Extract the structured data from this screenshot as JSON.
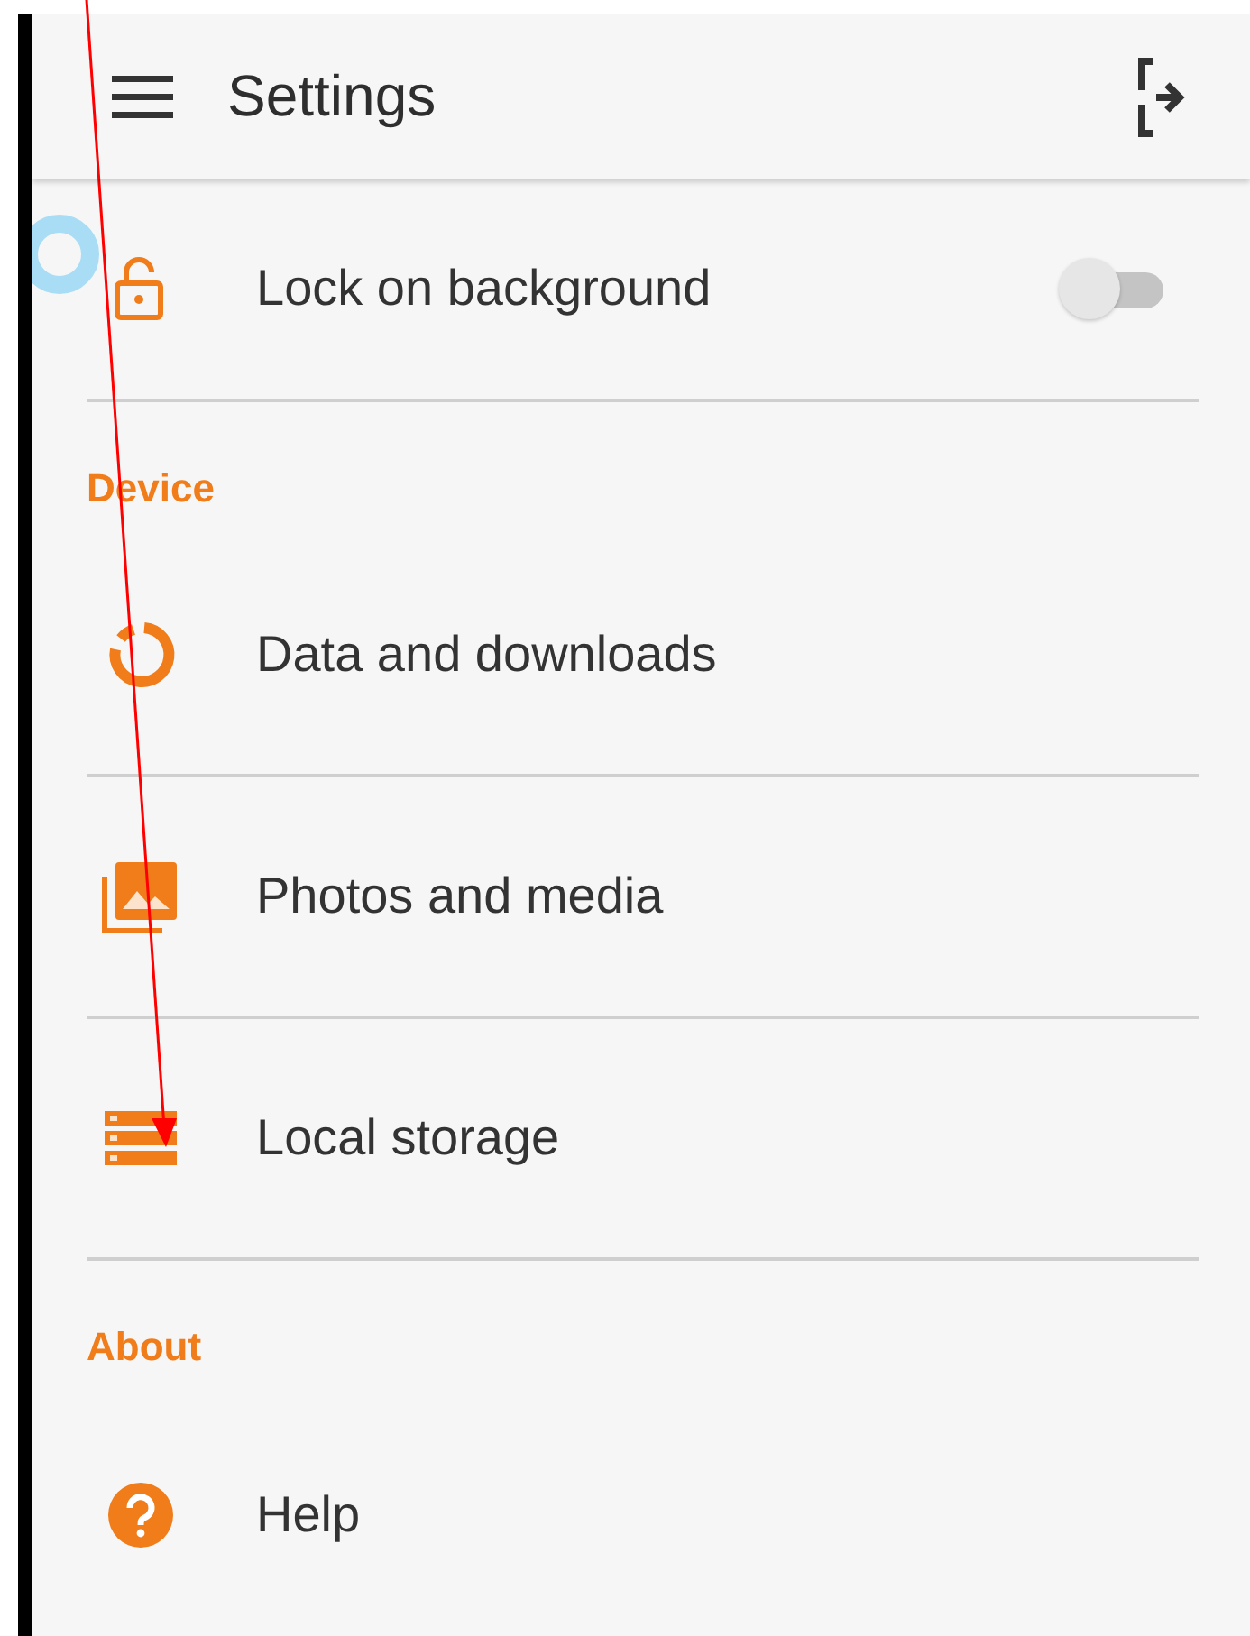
{
  "header": {
    "title": "Settings"
  },
  "sections": [
    {
      "items": [
        {
          "kind": "toggle",
          "label": "Lock on background",
          "on": false
        }
      ]
    },
    {
      "title": "Device",
      "items": [
        {
          "kind": "link",
          "label": "Data and downloads"
        },
        {
          "kind": "link",
          "label": "Photos and media"
        },
        {
          "kind": "link",
          "label": "Local storage"
        }
      ]
    },
    {
      "title": "About",
      "items": [
        {
          "kind": "link",
          "label": "Help"
        }
      ]
    }
  ]
}
